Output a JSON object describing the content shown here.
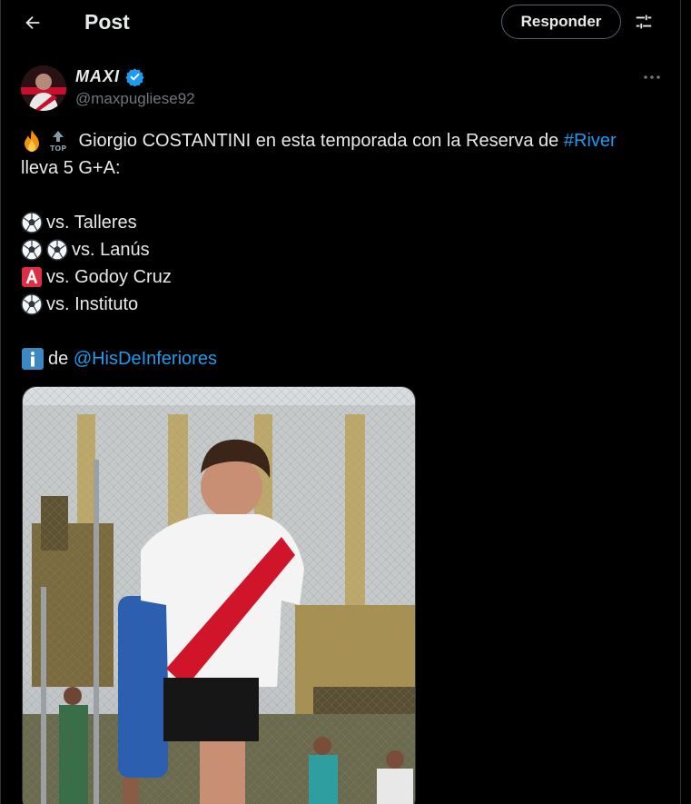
{
  "header": {
    "title": "Post",
    "reply_label": "Responder"
  },
  "author": {
    "name": "MAXI",
    "handle": "@maxpugliese92"
  },
  "tweet": {
    "line1_text": " Giorgio COSTANTINI en esta temporada con la Reserva de ",
    "line1_link": "#River",
    "line2": "lleva 5 G+A:",
    "items": [
      {
        "text": "vs. Talleres"
      },
      {
        "text": "vs. Lanús"
      },
      {
        "text": "vs. Godoy Cruz"
      },
      {
        "text": "vs. Instituto"
      }
    ],
    "source_prefix": "de ",
    "source_link": "@HisDeInferiores"
  },
  "colors": {
    "background": "#000000",
    "text": "#e7e9ea",
    "muted": "#71767b",
    "link": "#1d9bf0",
    "verified": "#1d9bf0",
    "assist_badge": "#e0243a",
    "info_badge": "#3b88c3"
  },
  "icons": [
    "back-arrow-icon",
    "settings-icon",
    "verified-badge-icon",
    "more-options-icon",
    "fire-icon",
    "top-arrow-icon",
    "soccer-ball-icon",
    "letter-a-icon",
    "information-icon"
  ]
}
